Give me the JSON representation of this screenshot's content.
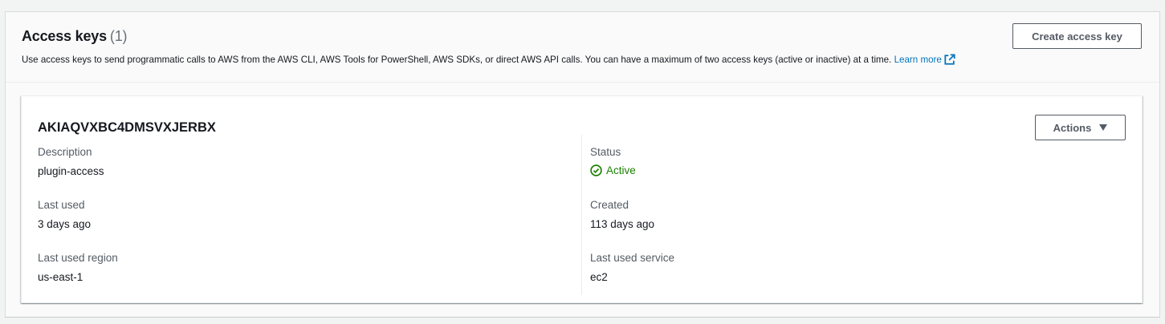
{
  "header": {
    "title": "Access keys",
    "count": "(1)",
    "description": "Use access keys to send programmatic calls to AWS from the AWS CLI, AWS Tools for PowerShell, AWS SDKs, or direct AWS API calls. You can have a maximum of two access keys (active or inactive) at a time.",
    "learn_more": "Learn more",
    "create_button": "Create access key"
  },
  "key": {
    "id": "AKIAQVXBC4DMSVXJERBX",
    "actions_button": "Actions",
    "description_label": "Description",
    "description_value": "plugin-access",
    "last_used_label": "Last used",
    "last_used_value": "3 days ago",
    "last_used_region_label": "Last used region",
    "last_used_region_value": "us-east-1",
    "status_label": "Status",
    "status_value": "Active",
    "created_label": "Created",
    "created_value": "113 days ago",
    "last_used_service_label": "Last used service",
    "last_used_service_value": "ec2"
  },
  "icons": {
    "external_link": "external-link-icon",
    "status": "check-circle-icon",
    "actions_caret": "caret-down-icon"
  },
  "colors": {
    "link": "#0073bb",
    "status_success": "#1d8102",
    "button_border": "#545b64"
  }
}
